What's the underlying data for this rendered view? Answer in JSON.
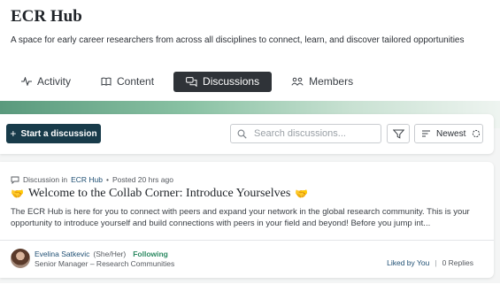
{
  "hub": {
    "title": "ECR Hub",
    "description": "A space for early career researchers from across all disciplines to connect, learn, and discover tailored opportunities"
  },
  "tabs": [
    {
      "label": "Activity",
      "icon": "activity-icon",
      "active": false
    },
    {
      "label": "Content",
      "icon": "book-icon",
      "active": false
    },
    {
      "label": "Discussions",
      "icon": "chat-bubbles-icon",
      "active": true
    },
    {
      "label": "Members",
      "icon": "people-icon",
      "active": false
    }
  ],
  "toolbar": {
    "start_label": "Start a discussion",
    "search_placeholder": "Search discussions...",
    "sort_label": "Newest"
  },
  "post": {
    "meta_prefix": "Discussion in",
    "hub_link": "ECR Hub",
    "posted": "Posted 20 hrs ago",
    "title": "Welcome to the Collab Corner: Introduce Yourselves",
    "excerpt": "The ECR Hub is here for you to connect with peers and expand your network in the global research community. This is your opportunity to introduce yourself and build connections with peers in your field and beyond!  Before you jump int...",
    "author": {
      "name": "Evelina Satkevic",
      "pronouns": "(She/Her)",
      "following": "Following",
      "role": "Senior Manager – Research Communities"
    },
    "liked": "Liked by You",
    "replies": "0 Replies"
  },
  "colors": {
    "primary_button": "#183b4a",
    "active_tab": "#2f3338",
    "link": "#1f4f73",
    "following": "#2d8a62",
    "band_start": "#5a9a7d"
  }
}
